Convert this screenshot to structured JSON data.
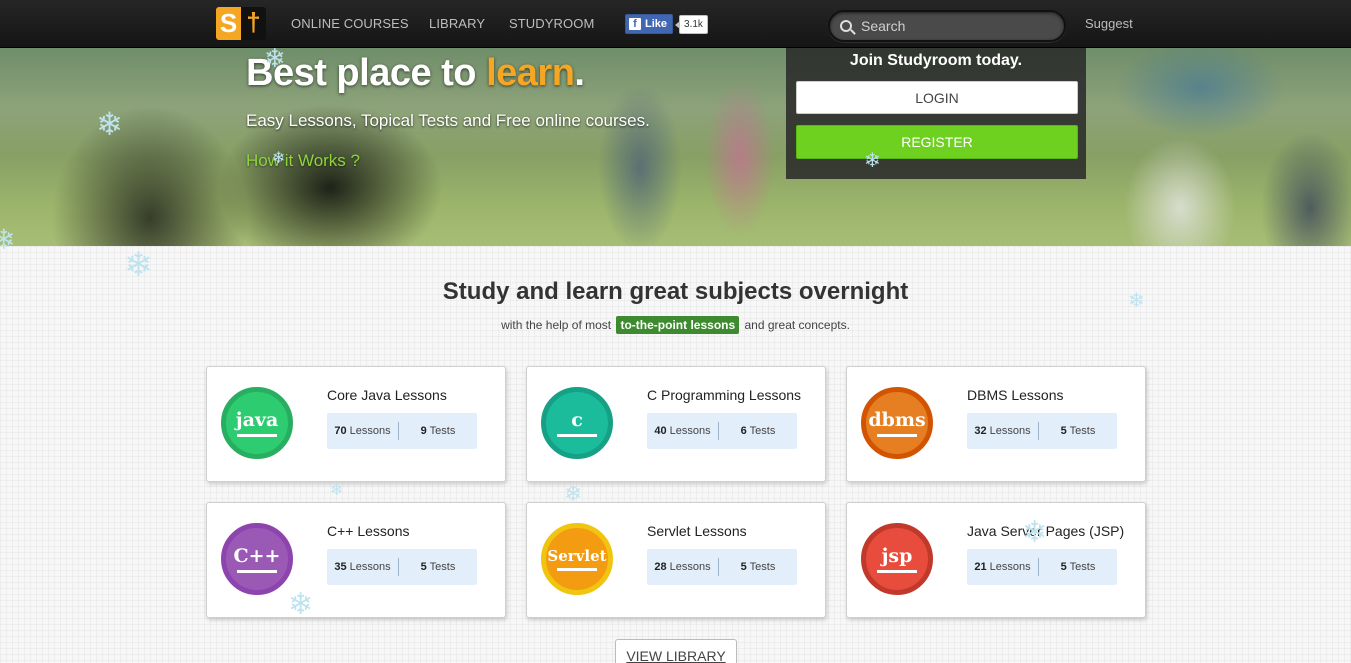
{
  "header": {
    "logo_left": "S",
    "logo_right": "†",
    "nav": [
      "ONLINE COURSES",
      "LIBRARY",
      "STUDYROOM"
    ],
    "fb_like_label": "Like",
    "fb_like_count": "3.1k",
    "search_placeholder": "Search",
    "suggest_label": "Suggest"
  },
  "hero": {
    "title_prefix": "Best place to ",
    "title_highlight": "learn",
    "title_suffix": ".",
    "subtitle": "Easy Lessons, Topical Tests and Free online courses.",
    "link": "How it Works ?",
    "join_title": "Join Studyroom today.",
    "login_label": "LOGIN",
    "register_label": "REGISTER"
  },
  "section": {
    "title": "Study and learn great subjects overnight",
    "sub_before": "with the help of most",
    "sub_tag": "to-the-point lessons",
    "sub_after": "and great concepts."
  },
  "courses": [
    {
      "title": "Core Java Lessons",
      "badge": "java",
      "color": "#2ecc71",
      "border": "#27ae60",
      "lessons": "70",
      "tests": "9"
    },
    {
      "title": "C Programming Lessons",
      "badge": "c",
      "color": "#1abc9c",
      "border": "#16a085",
      "lessons": "40",
      "tests": "6"
    },
    {
      "title": "DBMS Lessons",
      "badge": "dbms",
      "color": "#e67e22",
      "border": "#d35400",
      "lessons": "32",
      "tests": "5"
    },
    {
      "title": "C++ Lessons",
      "badge": "C++",
      "color": "#9b59b6",
      "border": "#8e44ad",
      "lessons": "35",
      "tests": "5"
    },
    {
      "title": "Servlet Lessons",
      "badge": "Servlet",
      "color": "#f39c12",
      "border": "#f1c40f",
      "lessons": "28",
      "tests": "5"
    },
    {
      "title": "Java Server Pages (JSP)",
      "badge": "jsp",
      "color": "#e74c3c",
      "border": "#c0392b",
      "lessons": "21",
      "tests": "5"
    }
  ],
  "labels": {
    "lessons": "Lessons",
    "tests": "Tests"
  },
  "view_library_label": "VIEW LIBRARY"
}
